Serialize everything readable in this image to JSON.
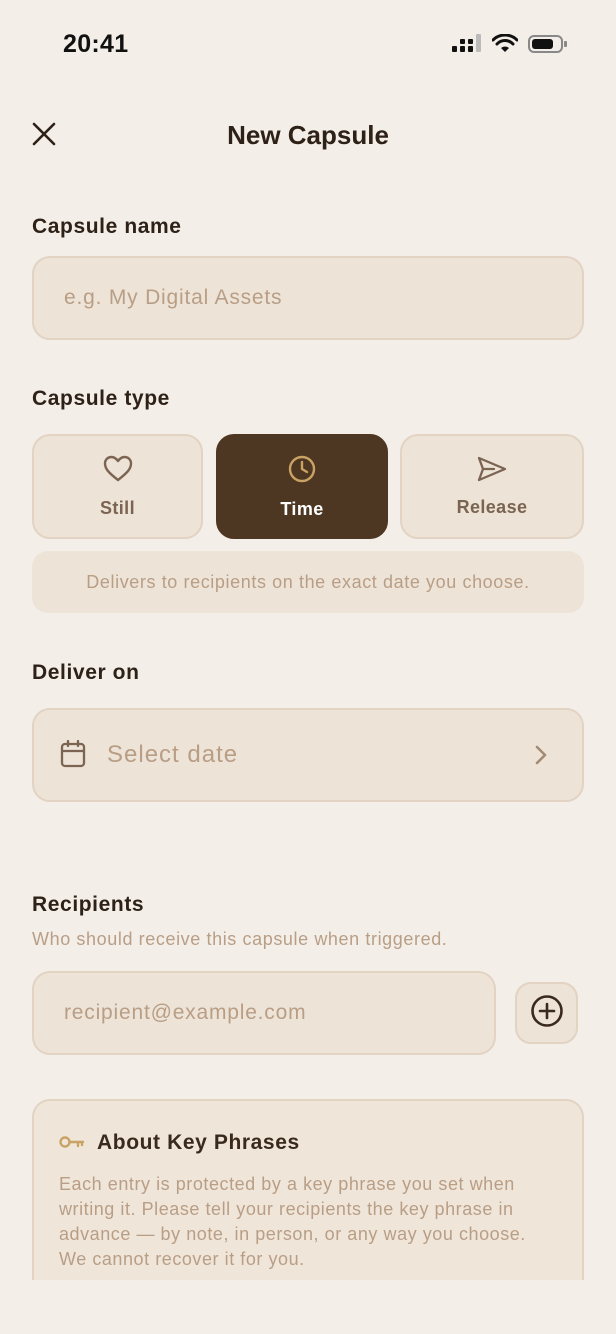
{
  "status_bar": {
    "time": "20:41"
  },
  "nav": {
    "title": "New Capsule"
  },
  "capsule_name": {
    "label": "Capsule name",
    "placeholder": "e.g. My Digital Assets",
    "value": ""
  },
  "capsule_type": {
    "label": "Capsule type",
    "options": [
      {
        "label": "Still",
        "icon": "heart-icon",
        "selected": false
      },
      {
        "label": "Time",
        "icon": "clock-icon",
        "selected": true
      },
      {
        "label": "Release",
        "icon": "send-icon",
        "selected": false
      }
    ],
    "description": "Delivers to recipients on the exact date you choose."
  },
  "deliver_on": {
    "label": "Deliver on",
    "placeholder": "Select date",
    "icon": "calendar-icon"
  },
  "recipients": {
    "label": "Recipients",
    "subtitle": "Who should receive this capsule when triggered.",
    "placeholder": "recipient@example.com",
    "value": "",
    "add_icon": "plus-circle-icon"
  },
  "key_phrases": {
    "title": "About Key Phrases",
    "icon": "key-icon",
    "body": "Each entry is protected by a key phrase you set when writing it. Please tell your recipients the key phrase in advance — by note, in person, or any way you choose. We cannot recover it for you."
  },
  "colors": {
    "background": "#f3eee8",
    "field": "#ede3d7",
    "field_border": "#e2d3c3",
    "selected": "#4d3622",
    "accent_gold": "#c8a364",
    "placeholder": "#b99e86",
    "text": "#2e2118"
  }
}
